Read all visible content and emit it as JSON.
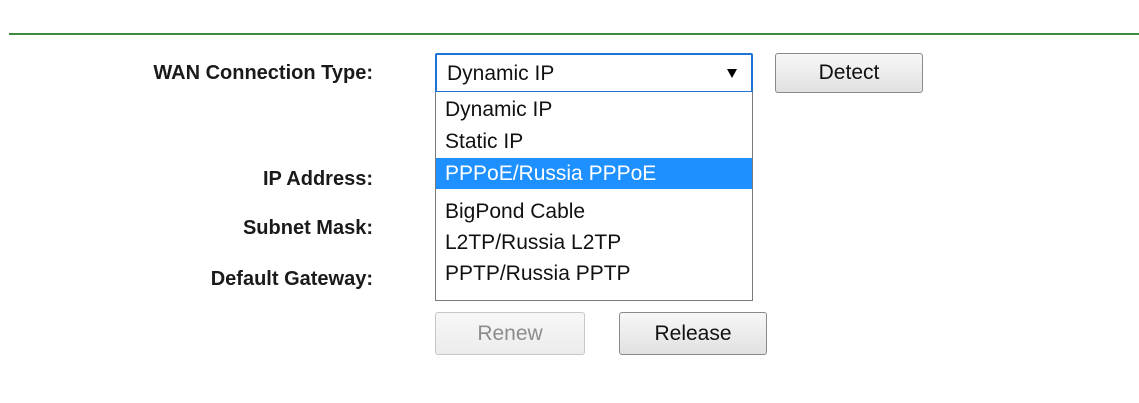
{
  "form": {
    "wan_label": "WAN Connection Type:",
    "ip_label": "IP Address:",
    "mask_label": "Subnet Mask:",
    "gateway_label": "Default Gateway:"
  },
  "wan_select": {
    "value": "Dynamic IP",
    "highlighted_option": "PPPoE/Russia PPPoE",
    "options": [
      "Dynamic IP",
      "Static IP",
      "PPPoE/Russia PPPoE",
      "BigPond Cable",
      "L2TP/Russia L2TP",
      "PPTP/Russia PPTP"
    ]
  },
  "buttons": {
    "detect": "Detect",
    "renew": "Renew",
    "release": "Release"
  },
  "colors": {
    "header_rule": "#3f8a3c",
    "select_focus": "#1f73d6",
    "highlight": "#1e90ff",
    "disabled_text": "#8c8c8c"
  },
  "icons": {
    "select_arrow": "chevron-down-icon"
  }
}
